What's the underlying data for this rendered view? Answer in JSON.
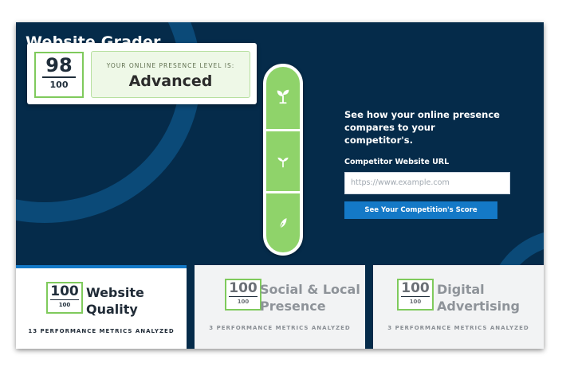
{
  "app": {
    "title": "Website Grader"
  },
  "score": {
    "value": "98",
    "total": "100"
  },
  "level": {
    "label": "YOUR ONLINE PRESENCE LEVEL IS:",
    "value": "Advanced"
  },
  "stages": [
    {
      "icon": "sprout-icon"
    },
    {
      "icon": "seedling-icon"
    },
    {
      "icon": "leaf-icon"
    }
  ],
  "competitor": {
    "headline": "See how your online presence compares to your competitor's.",
    "field_label": "Competitor Website URL",
    "placeholder": "https://www.example.com",
    "button_label": "See Your Competition's Score"
  },
  "categories": [
    {
      "score": "100",
      "total": "100",
      "title_line1": "Website",
      "title_line2": "Quality",
      "metrics": "13 PERFORMANCE METRICS ANALYZED",
      "active": true
    },
    {
      "score": "100",
      "total": "100",
      "title_line1": "Social & Local",
      "title_line2": "Presence",
      "metrics": "3 PERFORMANCE METRICS ANALYZED",
      "active": false
    },
    {
      "score": "100",
      "total": "100",
      "title_line1": "Digital",
      "title_line2": "Advertising",
      "metrics": "3 PERFORMANCE METRICS ANALYZED",
      "active": false
    }
  ],
  "colors": {
    "background": "#052b4a",
    "accent_green": "#8fd36a",
    "button_blue": "#1479c7"
  }
}
